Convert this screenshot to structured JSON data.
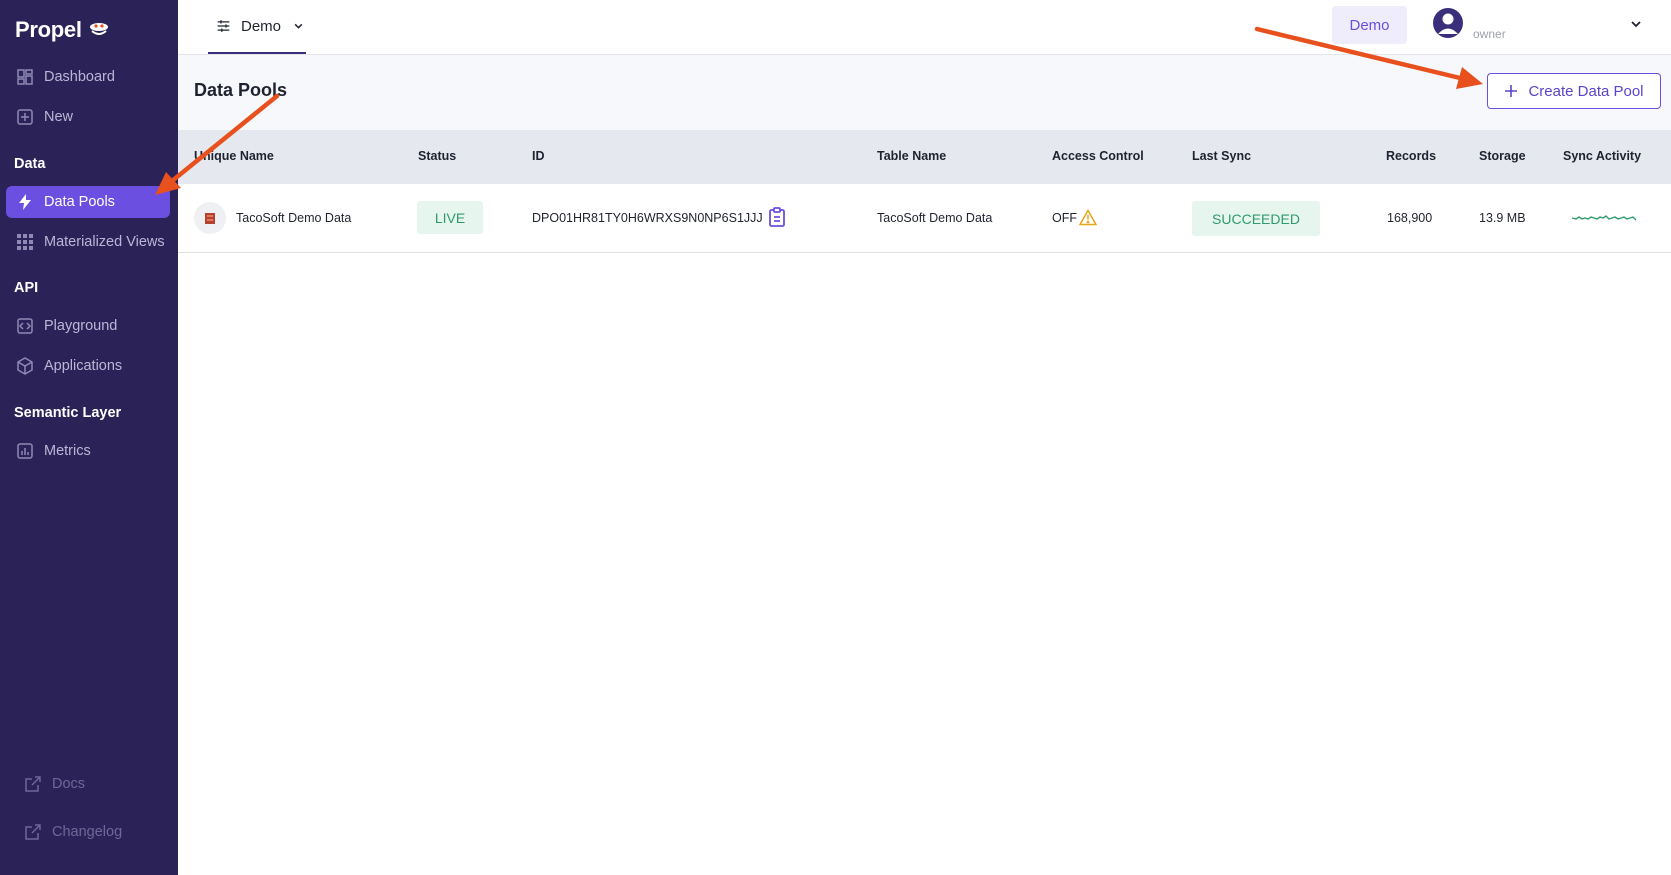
{
  "brand": {
    "name": "Propel"
  },
  "sidebar": {
    "top_items": [
      {
        "label": "Dashboard",
        "icon": "dashboard-icon"
      },
      {
        "label": "New",
        "icon": "plus-square-icon"
      }
    ],
    "sections": {
      "data": {
        "title": "Data",
        "items": [
          {
            "label": "Data Pools",
            "icon": "lightning-icon",
            "active": true
          },
          {
            "label": "Materialized Views",
            "icon": "grid-icon"
          }
        ]
      },
      "api": {
        "title": "API",
        "items": [
          {
            "label": "Playground",
            "icon": "code-icon"
          },
          {
            "label": "Applications",
            "icon": "cube-icon"
          }
        ]
      },
      "semantic": {
        "title": "Semantic Layer",
        "items": [
          {
            "label": "Metrics",
            "icon": "bar-chart-icon"
          }
        ]
      }
    },
    "footer_items": [
      {
        "label": "Docs",
        "icon": "external-link-icon"
      },
      {
        "label": "Changelog",
        "icon": "external-link-icon"
      }
    ]
  },
  "topbar": {
    "environment": "Demo",
    "env_badge": "Demo",
    "user_role": "owner"
  },
  "page": {
    "title": "Data Pools",
    "create_button": "Create Data Pool"
  },
  "table": {
    "columns": [
      "Unique Name",
      "Status",
      "ID",
      "Table Name",
      "Access Control",
      "Last Sync",
      "Records",
      "Storage",
      "Sync Activity"
    ],
    "rows": [
      {
        "unique_name": "TacoSoft Demo Data",
        "status": "LIVE",
        "id": "DPO01HR81TY0H6WRXS9N0NP6S1JJJ",
        "table_name": "TacoSoft Demo Data",
        "access_control": "OFF",
        "last_sync": "SUCCEEDED",
        "records": "168,900",
        "storage": "13.9 MB"
      }
    ]
  },
  "colors": {
    "sidebar_bg": "#2b2358",
    "accent": "#6a4fe0",
    "success": "#2f9b6e",
    "warning": "#e8a317",
    "annotation_arrow": "#e8501e"
  }
}
